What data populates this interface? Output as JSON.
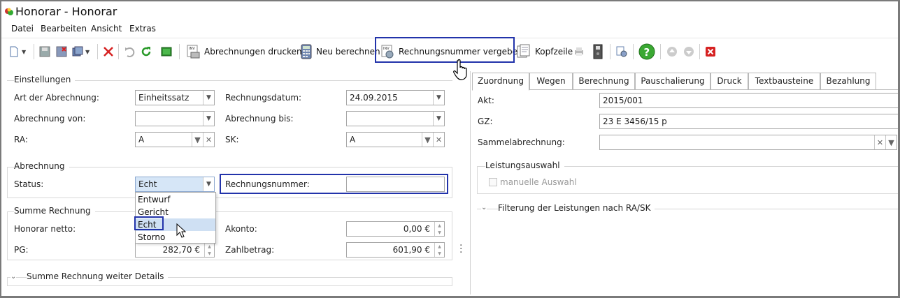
{
  "window": {
    "title": "Honorar - Honorar"
  },
  "menu": [
    "Datei",
    "Bearbeiten",
    "Ansicht",
    "Extras"
  ],
  "toolbar": {
    "print_invoices": "Abrechnungen drucken",
    "recalculate": "Neu berechnen",
    "assign_invoice_number": "Rechnungsnummer vergeben",
    "header": "Kopfzeile"
  },
  "settings": {
    "title": "Einstellungen",
    "billing_type_label": "Art der Abrechnung:",
    "billing_type_value": "Einheitssatz",
    "invoice_date_label": "Rechnungsdatum:",
    "invoice_date_value": "24.09.2015",
    "billing_from_label": "Abrechnung von:",
    "billing_from_value": "",
    "billing_to_label": "Abrechnung bis:",
    "billing_to_value": "",
    "ra_label": "RA:",
    "ra_value": "A",
    "sk_label": "SK:",
    "sk_value": "A"
  },
  "billing": {
    "title": "Abrechnung",
    "status_label": "Status:",
    "status_value": "Echt",
    "status_options": [
      "Entwurf",
      "Gericht",
      "Echt",
      "Storno"
    ],
    "invoice_number_label": "Rechnungsnummer:",
    "invoice_number_value": ""
  },
  "sum": {
    "title": "Summe Rechnung",
    "fee_net_label": "Honorar netto:",
    "advance_label": "Akonto:",
    "advance_value": "0,00 €",
    "pg_label": "PG:",
    "pg_value": "282,70 €",
    "payment_label": "Zahlbetrag:",
    "payment_value": "601,90 €",
    "more_details": "Summe Rechnung weiter Details"
  },
  "tabs": [
    "Zuordnung",
    "Wegen",
    "Berechnung",
    "Pauschalierung",
    "Druck",
    "Textbausteine",
    "Bezahlung"
  ],
  "assignment": {
    "akt_label": "Akt:",
    "akt_value": "2015/001",
    "gz_label": "GZ:",
    "gz_value": "23 E 3456/15 p",
    "collective_label": "Sammelabrechnung:",
    "collective_value": "",
    "services_title": "Leistungsauswahl",
    "manual_selection_label": "manuelle Auswahl",
    "filter_title": "Filterung der Leistungen nach RA/SK"
  },
  "colors": {
    "highlight": "#2233aa",
    "selected_row": "#cfe0f3",
    "help": "#3aa832",
    "delete": "#d62222"
  }
}
